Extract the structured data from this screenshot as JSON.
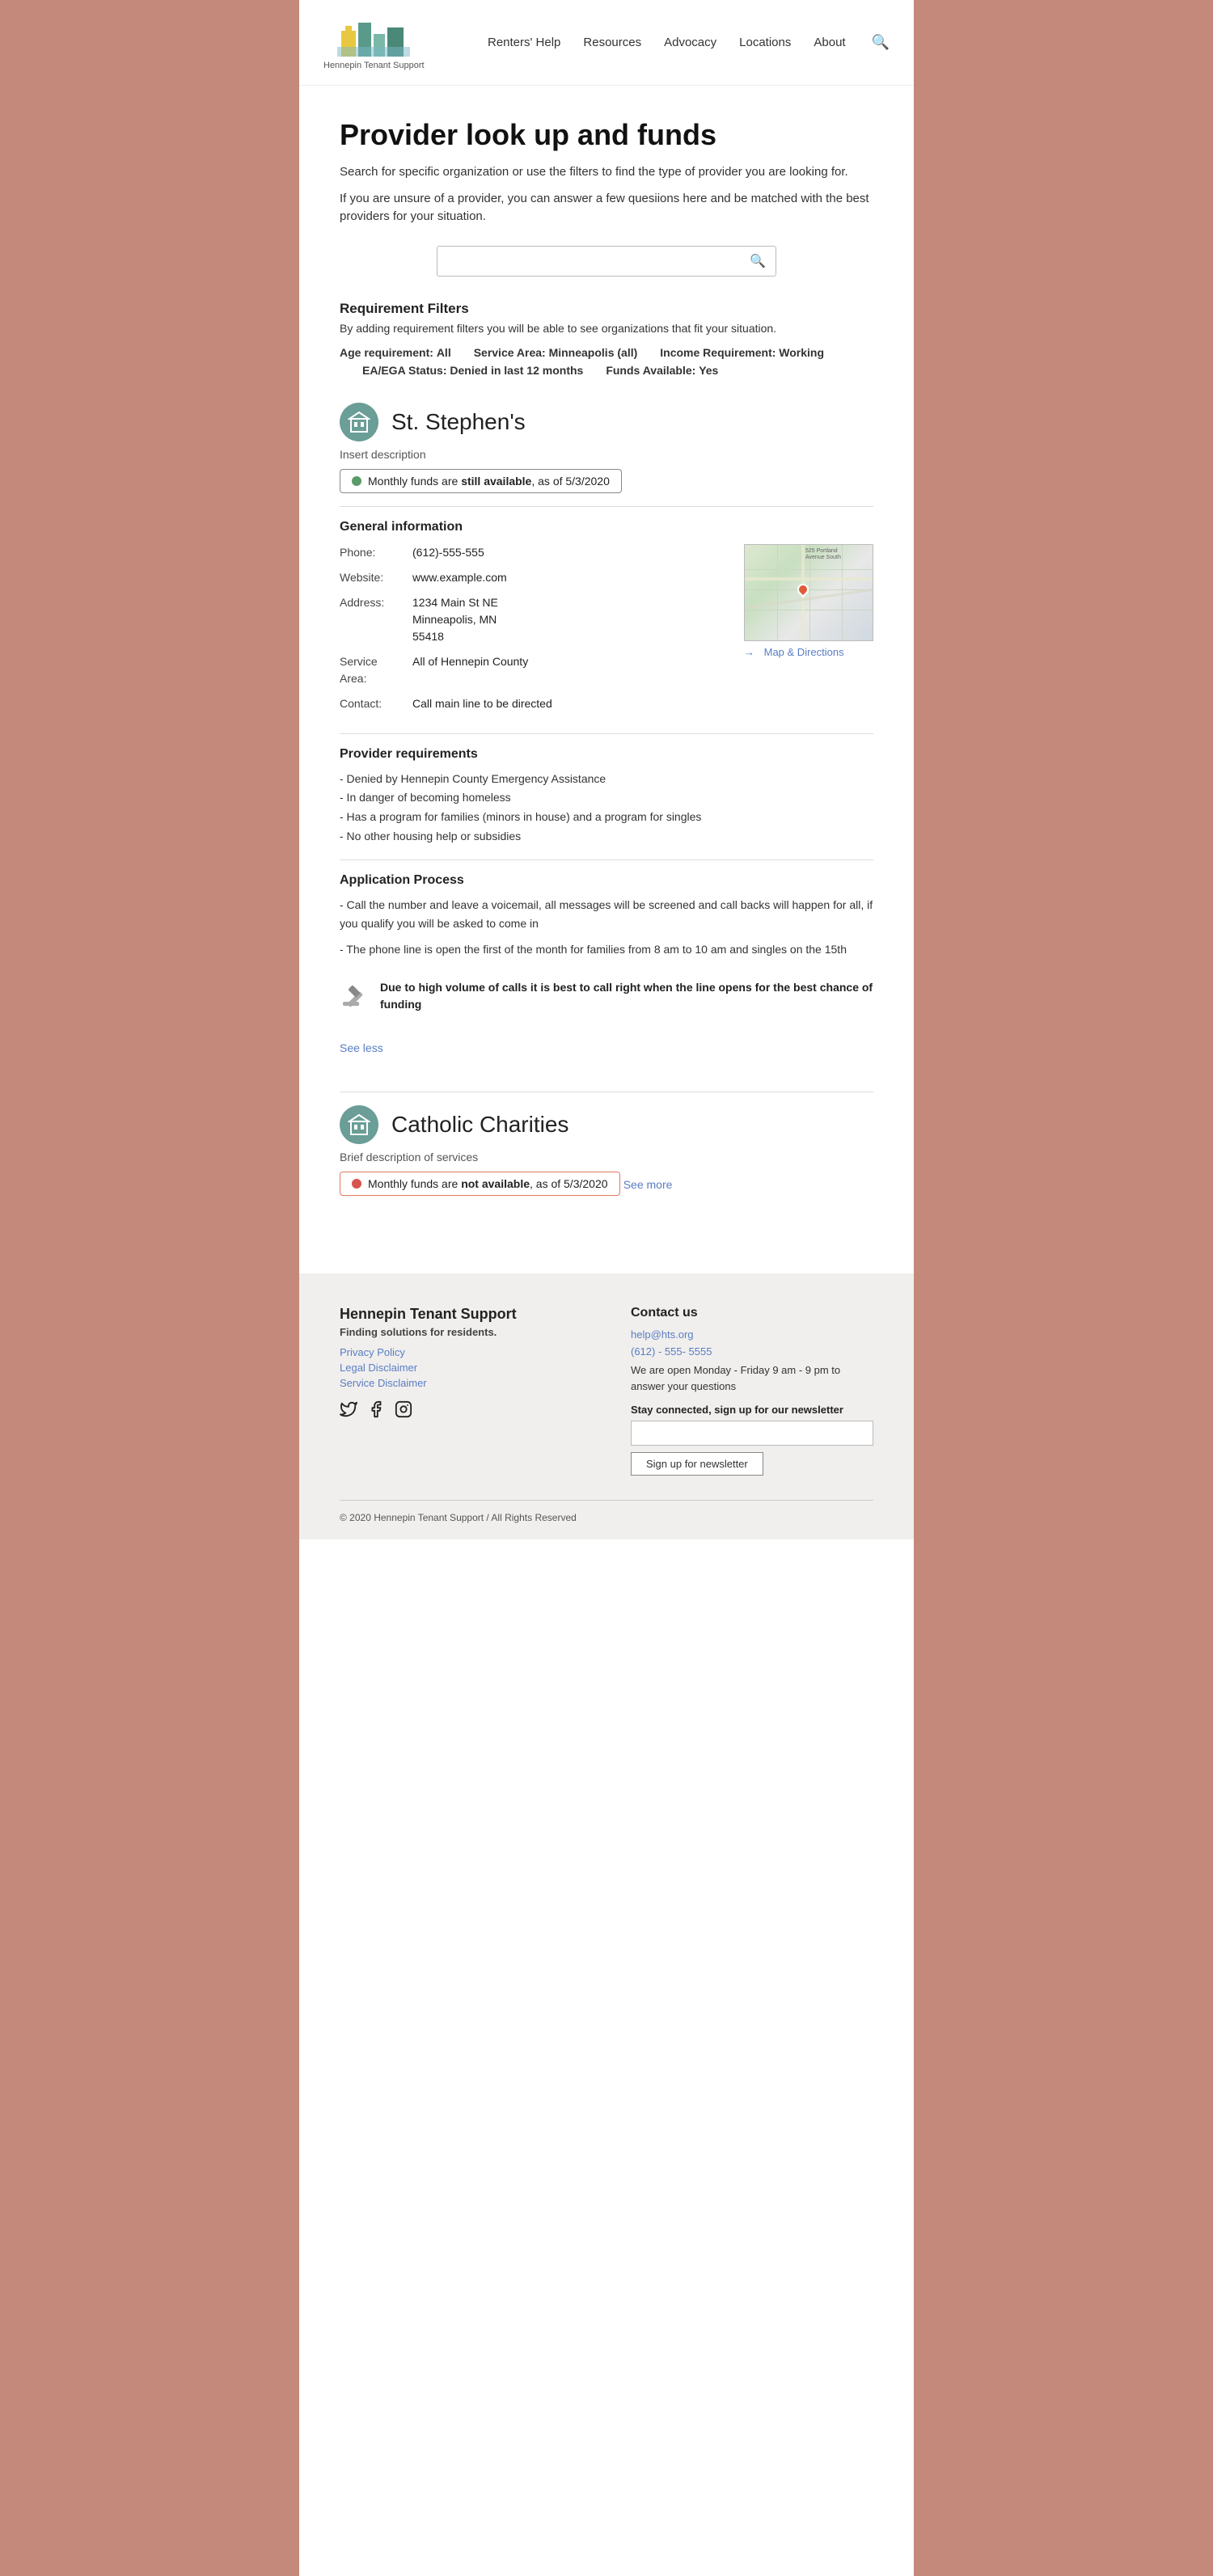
{
  "header": {
    "logo_text": "Hennepin Tenant Support",
    "nav": {
      "items": [
        {
          "label": "Renters' Help",
          "href": "#"
        },
        {
          "label": "Resources",
          "href": "#"
        },
        {
          "label": "Advocacy",
          "href": "#"
        },
        {
          "label": "Locations",
          "href": "#"
        },
        {
          "label": "About",
          "href": "#"
        }
      ]
    }
  },
  "page": {
    "title": "Provider look up and funds",
    "subtitle1": "Search for specific organization or use the filters to find the type of provider you are looking for.",
    "subtitle2": "If you are unsure of a provider, you can answer a few quesiions here and be matched with the best providers for your situation.",
    "search_placeholder": ""
  },
  "filters": {
    "title": "Requirement Filters",
    "desc": "By adding requirement filters you will be able to see organizations that fit your situation.",
    "age": {
      "label": "Age requirement:",
      "value": "All"
    },
    "service_area": {
      "label": "Service Area:",
      "value": "Minneapolis (all)"
    },
    "income": {
      "label": "Income Requirement:",
      "value": "Working"
    },
    "ea_ega": {
      "label": "EA/EGA Status:",
      "value": "Denied in last 12 months"
    },
    "funds": {
      "label": "Funds Available:",
      "value": "Yes"
    }
  },
  "providers": [
    {
      "id": "st-stephens",
      "name": "St. Stephen's",
      "description": "Insert description",
      "status_text": "Monthly funds are",
      "status_bold": "still available",
      "status_date": ", as of 5/3/2020",
      "status_type": "available",
      "general_info": {
        "title": "General information",
        "phone": "(612)-555-555",
        "website": "www.example.com",
        "address_line1": "1234 Main St NE",
        "address_line2": "Minneapolis, MN",
        "address_line3": "55418",
        "service_area": "All of Hennepin County",
        "contact": "Call main line to be directed",
        "map_directions_label": "Map & Directions",
        "map_arrow": "→"
      },
      "requirements": {
        "title": "Provider requirements",
        "items": [
          "- Denied by Hennepin County Emergency Assistance",
          "- In danger of becoming homeless",
          "- Has a program for families (minors in house) and a program for singles",
          "- No other housing help or subsidies"
        ]
      },
      "application": {
        "title": "Application Process",
        "items": [
          "- Call the number and leave a voicemail, all messages will be screened and call backs will happen for all, if you qualify you will be asked to come in",
          "- The phone line is open the first of the month for families from 8 am to 10 am and singles on the 15th"
        ],
        "alert": "Due to high volume of calls it is best to call right when the line opens for the best chance of funding"
      },
      "see_less_label": "See less",
      "expanded": true
    },
    {
      "id": "catholic-charities",
      "name": "Catholic Charities",
      "description": "Brief description of services",
      "status_text": "Monthly funds are",
      "status_bold": "not available",
      "status_date": ", as of 5/3/2020",
      "status_type": "not-available",
      "see_more_label": "See more",
      "expanded": false
    }
  ],
  "footer": {
    "org_name": "Hennepin Tenant Support",
    "tagline": "Finding solutions for residents.",
    "links": [
      {
        "label": "Privacy Policy",
        "href": "#"
      },
      {
        "label": "Legal Disclaimer",
        "href": "#"
      },
      {
        "label": "Service Disclaimer",
        "href": "#"
      }
    ],
    "social": [
      "twitter",
      "facebook",
      "instagram"
    ],
    "contact": {
      "title": "Contact us",
      "email": "help@hts.org",
      "phone": "(612) - 555- 5555",
      "hours_text": "We are open Monday - Friday 9 am - 9 pm to answer your questions",
      "newsletter_label": "Stay connected, sign up for our newsletter",
      "newsletter_placeholder": "",
      "newsletter_btn": "Sign up for newsletter"
    },
    "copyright": "© 2020 Hennepin Tenant Support / All Rights Reserved"
  }
}
